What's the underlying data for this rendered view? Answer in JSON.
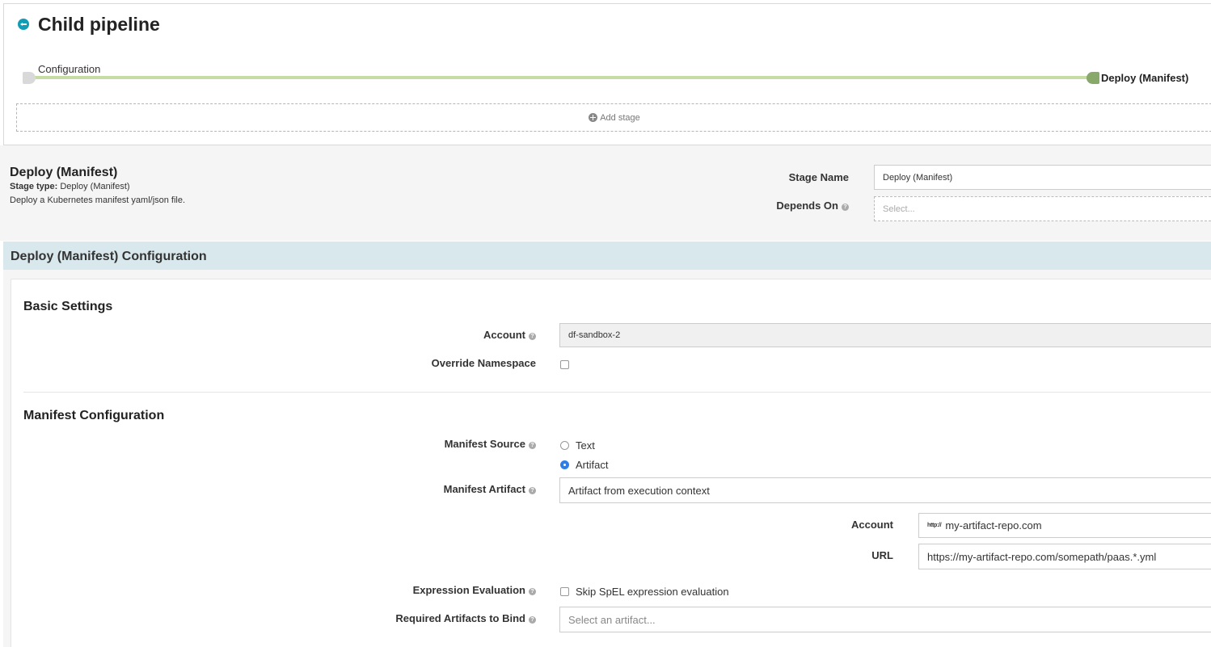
{
  "header": {
    "title": "Child pipeline"
  },
  "graph": {
    "start_stage": "Configuration",
    "end_stage": "Deploy (Manifest)",
    "add_stage_label": "Add stage"
  },
  "stage": {
    "title": "Deploy (Manifest)",
    "type_label": "Stage type:",
    "type_value": "Deploy (Manifest)",
    "description": "Deploy a Kubernetes manifest yaml/json file.",
    "name_label": "Stage Name",
    "name_value": "Deploy (Manifest)",
    "depends_label": "Depends On",
    "depends_placeholder": "Select..."
  },
  "config": {
    "title": "Deploy (Manifest) Configuration",
    "basic": {
      "title": "Basic Settings",
      "account_label": "Account",
      "account_value": "df-sandbox-2",
      "override_label": "Override Namespace"
    },
    "manifest": {
      "title": "Manifest Configuration",
      "source_label": "Manifest Source",
      "source_options": [
        "Text",
        "Artifact"
      ],
      "source_selected": "Artifact",
      "artifact_label": "Manifest Artifact",
      "artifact_value": "Artifact from execution context",
      "artifact_account_label": "Account",
      "artifact_account_icon": "http://",
      "artifact_account_value": "my-artifact-repo.com",
      "url_label": "URL",
      "url_value": "https://my-artifact-repo.com/somepath/paas.*.yml",
      "expr_label": "Expression Evaluation",
      "expr_option": "Skip SpEL expression evaluation",
      "required_label": "Required Artifacts to Bind",
      "required_placeholder": "Select an artifact..."
    }
  },
  "colors": {
    "accent": "#139cb5",
    "pipeline_line": "#c6dca4",
    "stage_node_done": "#88a96a",
    "radio_selected": "#2f7ee6",
    "config_header_bg": "#d8e8ec"
  }
}
